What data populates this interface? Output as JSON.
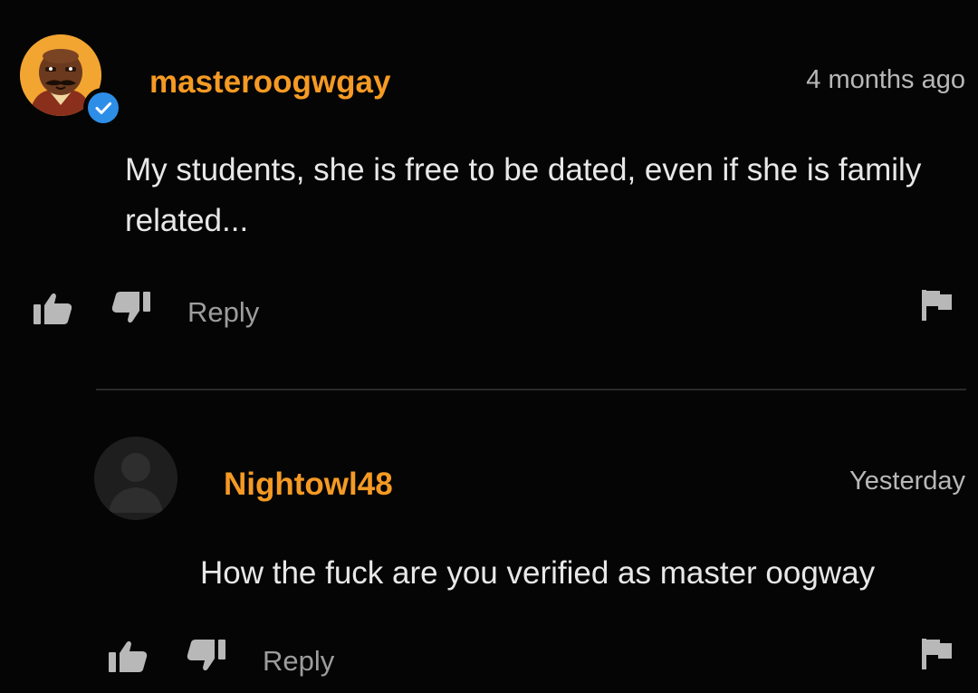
{
  "comments": [
    {
      "username": "masteroogwgay",
      "time": "4 months ago",
      "text": "My students, she is free to be dated, even if she is family related...",
      "reply_label": "Reply",
      "verified": true
    },
    {
      "username": "Nightowl48",
      "time": "Yesterday",
      "text": "How the fuck are you verified as master oogway",
      "reply_label": "Reply",
      "verified": false
    }
  ],
  "icons": {
    "like": "thumbs-up-icon",
    "dislike": "thumbs-down-icon",
    "flag": "flag-icon",
    "verified": "verified-check-icon"
  },
  "colors": {
    "background": "#050505",
    "username": "#f59a23",
    "verified_badge": "#2d8ee8",
    "avatar_bg": "#f2a531"
  }
}
